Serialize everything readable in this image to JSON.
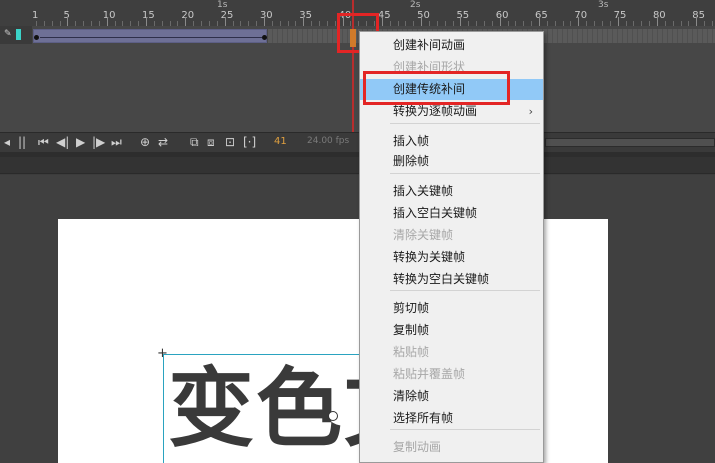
{
  "timeline": {
    "second_labels": [
      "1s",
      "2s",
      "3s"
    ],
    "frame_numbers": [
      "1",
      "5",
      "10",
      "15",
      "20",
      "25",
      "30",
      "35",
      "40",
      "45",
      "50",
      "55",
      "60",
      "65",
      "70",
      "75",
      "80",
      "85"
    ],
    "current_frame": "41",
    "fps": "24.00 fps"
  },
  "context_menu": {
    "items": [
      {
        "label": "创建补间动画",
        "enabled": true
      },
      {
        "label": "创建补间形状",
        "enabled": false
      },
      {
        "label": "创建传统补间",
        "enabled": true,
        "highlighted": true
      },
      {
        "label": "转换为逐帧动画",
        "enabled": true,
        "submenu": true
      },
      {
        "label": "插入帧",
        "enabled": true
      },
      {
        "label": "删除帧",
        "enabled": true
      },
      {
        "label": "插入关键帧",
        "enabled": true
      },
      {
        "label": "插入空白关键帧",
        "enabled": true
      },
      {
        "label": "清除关键帧",
        "enabled": false
      },
      {
        "label": "转换为关键帧",
        "enabled": true
      },
      {
        "label": "转换为空白关键帧",
        "enabled": true
      },
      {
        "label": "剪切帧",
        "enabled": true
      },
      {
        "label": "复制帧",
        "enabled": true
      },
      {
        "label": "粘贴帧",
        "enabled": false
      },
      {
        "label": "粘贴并覆盖帧",
        "enabled": false
      },
      {
        "label": "清除帧",
        "enabled": true
      },
      {
        "label": "选择所有帧",
        "enabled": true
      },
      {
        "label": "复制动画",
        "enabled": false
      }
    ],
    "submenu_arrow": "›"
  },
  "stage": {
    "text": "变色文"
  },
  "colors": {
    "highlight": "#91c9f7",
    "annotation_red": "#e32525",
    "tween_span": "#6e7096",
    "playhead": "#b82d2d"
  }
}
